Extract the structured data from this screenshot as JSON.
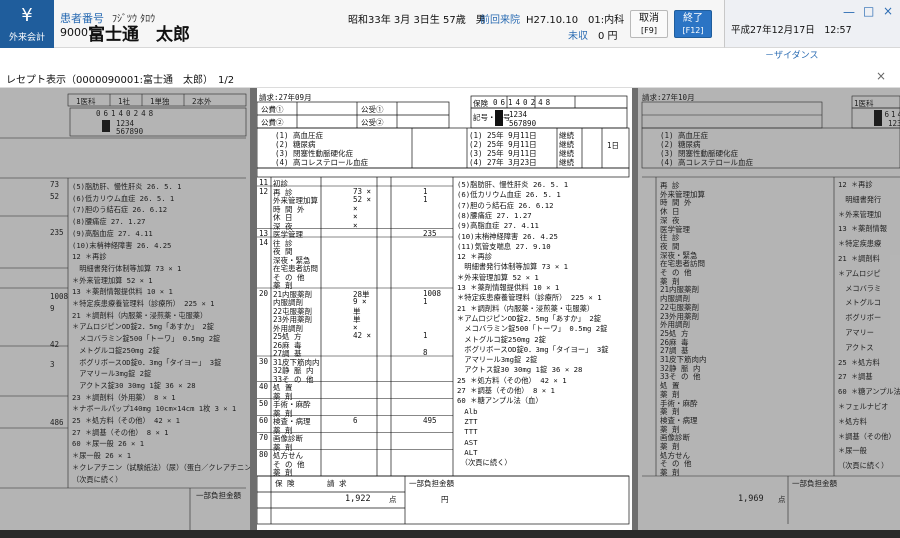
{
  "header": {
    "app_button_label": "外来会計",
    "patient_number_label": "患者番号",
    "patient_number": "90001",
    "patient_kana": "ﾌｼﾞﾂｳ ﾀﾛｳ",
    "patient_name": "富士通　太郎",
    "birth_info": "昭和33年 3月 3日生 57歳　男",
    "prev_visit_label": "前回来院",
    "prev_visit": "H27.10.10　01:内科",
    "unpaid_label": "未収",
    "unpaid_amount": "0 円",
    "cancel_label": "取消",
    "cancel_key": "[F9]",
    "finish_label": "終了",
    "finish_key": "[F12]",
    "date_time": "平成27年12月17日　12:57",
    "side_note": "－ザイダンス"
  },
  "viewer": {
    "title": "レセプト表示（0000090001:富士通　太郎）　1/2",
    "close_glyph": "×"
  },
  "receipt_main": {
    "claim_month": "請求:27年09月",
    "insurer_label": "保険",
    "insurer_number": "06140248",
    "symbol_label": "記号・番号",
    "symbol": "1234",
    "number": "567890",
    "public1": "公費①",
    "public2": "公費②",
    "public_recipient1": "公受①",
    "public_recipient2": "公受②",
    "diseases": [
      "(1) 高血圧症",
      "(2) 糖尿病",
      "(3) 閉塞性動脈硬化症",
      "(4) 高コレステロール血症"
    ],
    "start_dates": [
      "(1) 25年 9月11日",
      "(2) 25年 9月11日",
      "(3) 25年 9月11日",
      "(4) 27年 3月23日"
    ],
    "outcome_labels": [
      "継続",
      "継続",
      "継続",
      "継続"
    ],
    "days_label": "1日",
    "rows": [
      {
        "code": "11",
        "label": "初診",
        "pts": "",
        "cnt": ""
      },
      {
        "code": "12",
        "label": "再 診",
        "pts": "73 ×",
        "cnt": "1"
      },
      {
        "code": "",
        "label": "外来管理加算",
        "pts": "52 ×",
        "cnt": "1"
      },
      {
        "code": "",
        "label": "時 間 外",
        "pts": "×",
        "cnt": ""
      },
      {
        "code": "",
        "label": "休 日",
        "pts": "×",
        "cnt": ""
      },
      {
        "code": "",
        "label": "深 夜",
        "pts": "×",
        "cnt": ""
      },
      {
        "code": "13",
        "label": "医学管理",
        "pts": "",
        "cnt": "235"
      },
      {
        "code": "14",
        "label": "往 診",
        "pts": "",
        "cnt": ""
      },
      {
        "code": "",
        "label": "夜 間",
        "pts": "",
        "cnt": ""
      },
      {
        "code": "",
        "label": "深夜・緊急",
        "pts": "",
        "cnt": ""
      },
      {
        "code": "",
        "label": "在宅患者訪問",
        "pts": "",
        "cnt": ""
      },
      {
        "code": "",
        "label": "そ の 他",
        "pts": "",
        "cnt": ""
      },
      {
        "code": "",
        "label": "薬 剤",
        "pts": "",
        "cnt": ""
      },
      {
        "code": "20",
        "label": "21内服薬剤",
        "pts": "28単",
        "cnt": "1008"
      },
      {
        "code": "",
        "label": "内服調剤",
        "pts": "9 ×",
        "cnt": "1"
      },
      {
        "code": "",
        "label": "22屯服薬剤",
        "pts": "単",
        "cnt": ""
      },
      {
        "code": "",
        "label": "23外用薬剤",
        "pts": "単",
        "cnt": ""
      },
      {
        "code": "",
        "label": "外用調剤",
        "pts": "×",
        "cnt": ""
      },
      {
        "code": "",
        "label": "25処 方",
        "pts": "42 ×",
        "cnt": "1"
      },
      {
        "code": "",
        "label": "26麻 毒",
        "pts": "",
        "cnt": ""
      },
      {
        "code": "",
        "label": "27調 基",
        "pts": "",
        "cnt": "8"
      },
      {
        "code": "30",
        "label": "31皮下筋肉内",
        "pts": "",
        "cnt": ""
      },
      {
        "code": "",
        "label": "32静 脈 内",
        "pts": "",
        "cnt": ""
      },
      {
        "code": "",
        "label": "33そ の 他",
        "pts": "",
        "cnt": ""
      },
      {
        "code": "40",
        "label": "処 置",
        "pts": "",
        "cnt": ""
      },
      {
        "code": "",
        "label": "薬 剤",
        "pts": "",
        "cnt": ""
      },
      {
        "code": "50",
        "label": "手術・麻酔",
        "pts": "",
        "cnt": ""
      },
      {
        "code": "",
        "label": "薬 剤",
        "pts": "",
        "cnt": ""
      },
      {
        "code": "60",
        "label": "検査・病理",
        "pts": "6",
        "cnt": "495"
      },
      {
        "code": "",
        "label": "薬 剤",
        "pts": "",
        "cnt": ""
      },
      {
        "code": "70",
        "label": "画像診断",
        "pts": "",
        "cnt": ""
      },
      {
        "code": "",
        "label": "薬 剤",
        "pts": "",
        "cnt": ""
      },
      {
        "code": "80",
        "label": "処方せん",
        "pts": "",
        "cnt": ""
      },
      {
        "code": "",
        "label": "そ の 他",
        "pts": "",
        "cnt": ""
      },
      {
        "code": "",
        "label": "薬 剤",
        "pts": "",
        "cnt": ""
      }
    ],
    "details": [
      "(5)脂肪肝、慢性肝炎   26. 5. 1",
      "(6)低カリウム血症   26. 5. 1",
      "(7)胆のう結石症   26. 6.12",
      "(8)腰痛症   27. 1.27",
      "(9)高脂血症   27. 4.11",
      "(10)末梢神経障害   26. 4.25",
      "(11)気管支喘息   27. 9.10",
      "12 ＊再診",
      "　明細書発行体制等加算   73 × 1",
      "＊外来管理加算   52 × 1",
      "13 ＊薬剤情報提供料   10 × 1",
      "＊特定疾患療養管理料（診療所）   225 × 1",
      "21 ＊調剤料（内服薬・浸煎薬・屯服薬）",
      "＊アムロジピンOD錠2．5mg「あすか」 2錠",
      "　メコバラミン錠500「トーワ」 0.5mg 2錠",
      "　メトグルコ錠250mg 2錠",
      "　ボグリボースOD錠0．3mg「タイヨー」 3錠",
      "　アマリール3mg錠 2錠",
      "　アクトス錠30 30mg 1錠   36 × 28",
      "25 ＊処方料（その他）   42 × 1",
      "27 ＊調基（その他）   8 × 1",
      "60 ＊糖アンプル法（血）",
      "　Alb",
      "　ZTT",
      "　TTT",
      "　AST",
      "　ALT",
      "　（次頁に続く）"
    ],
    "footer": {
      "insurance_label": "保 険",
      "claim_label": "請 求",
      "points_label": "点",
      "amount": "1,922",
      "partial_label": "一部負担金額",
      "yen_label": "円"
    }
  },
  "receipt_left": {
    "header_cells": [
      "1医科",
      "1社",
      "1単独",
      "2本外"
    ],
    "insurer_number": "06140248",
    "symbol": "1234",
    "number": "567890",
    "details": [
      "(5)脂肪肝、慢性肝炎 26. 5. 1",
      "(6)低カリウム血症 26. 5. 1",
      "(7)胆のう結石症 26. 6.12",
      "(8)腰痛症 27. 1.27",
      "(9)高脂血症 27. 4.11",
      "(10)末梢神経障害 26. 4.25",
      "12 ＊再診",
      "　明細書発行体制等加算 73 × 1",
      "＊外来管理加算 52 × 1",
      "13 ＊薬剤情報提供料 10 × 1",
      "＊特定疾患療養管理料（診療所） 225 × 1",
      "21 ＊調剤料（内服薬・浸煎薬・屯服薬）",
      "＊アムロジピンOD錠2．5mg「あすか」 2錠",
      "　メコバラミン錠500「トーワ」 0.5mg 2錠",
      "　メトグルコ錠250mg 2錠",
      "　ボグリボースOD錠0．3mg「タイヨー」 3錠",
      "　アマリール3mg錠 2錠",
      "　アクトス錠30 30mg 1錠 36 × 28",
      "23 ＊調剤料（外用薬） 8 × 1",
      "＊ナボールパップ140mg 10cm×14cm 1枚 3 × 1",
      "25 ＊処方料（その他） 42 × 1",
      "27 ＊調基（その他） 8 × 1",
      "60 ＊尿一般 26 × 1",
      "＊尿一般 26 × 1",
      "＊クレアチニン（試験紙法）（尿）（蛋白／クレアチニン比） 11 × 1",
      "（次頁に続く）"
    ],
    "left_values": [
      "73",
      "52",
      "235",
      "1008",
      "9",
      "42",
      "3",
      "486"
    ],
    "footer_partial": "一部負担金額",
    "yen": "円"
  },
  "receipt_right": {
    "claim_month": "請求:27年10月",
    "header_cells": [
      "1医科",
      "1社",
      "1単独",
      "2本外"
    ],
    "insurer_number": "06140248",
    "symbol": "1234",
    "number": "567890",
    "diseases": [
      "(1) 高血圧症",
      "(2) 糖尿病",
      "(3) 閉塞性動脈硬化症",
      "(4) 高コレステロール血症"
    ],
    "codes": [
      "(5)脂肪肝",
      "(6)低カリウ",
      "(7)胆のう結",
      "(8)腰痛症",
      "(9)高脂血症",
      "(10)末梢神",
      "(11)気管支喘"
    ],
    "items": [
      "再 診",
      "外来管理加算",
      "時 間 外",
      "休 日",
      "深 夜",
      "医学管理",
      "往 診",
      "夜 間",
      "深夜・緊急",
      "在宅患者訪問",
      "そ の 他",
      "薬 剤",
      "21内服薬剤",
      "内服調剤",
      "22屯服薬剤",
      "23外用薬剤",
      "外用調剤",
      "25処 方",
      "26麻 毒",
      "27調 基",
      "31皮下筋肉内",
      "32静 脈 内",
      "33そ の 他",
      "処 置",
      "薬 剤",
      "手術・麻酔",
      "薬 剤",
      "検査・病理",
      "薬 剤",
      "画像診断",
      "薬 剤",
      "処方せん",
      "そ の 他",
      "薬 剤"
    ],
    "notes": [
      "12 ＊再診",
      "　明細書発行",
      "＊外来管理加",
      "13 ＊薬剤情報",
      "＊特定疾患療",
      "21 ＊調剤料",
      "＊アムロジピ",
      "　メコバラミ",
      "　メトグルコ",
      "　ボグリボー",
      "　アマリー",
      "　アクトス",
      "25 ＊処方料",
      "27 ＊調基",
      "60 ＊糖アンプル法",
      "＊フェルナビオ",
      "＊処方料",
      "＊調基（その他）",
      "＊尿一般",
      "（次頁に続く）"
    ],
    "amount": "1,969",
    "points_label": "点",
    "partial_label": "一部負担金額"
  },
  "window_controls": {
    "minimize": "—",
    "maximize": "□",
    "close": "×"
  }
}
